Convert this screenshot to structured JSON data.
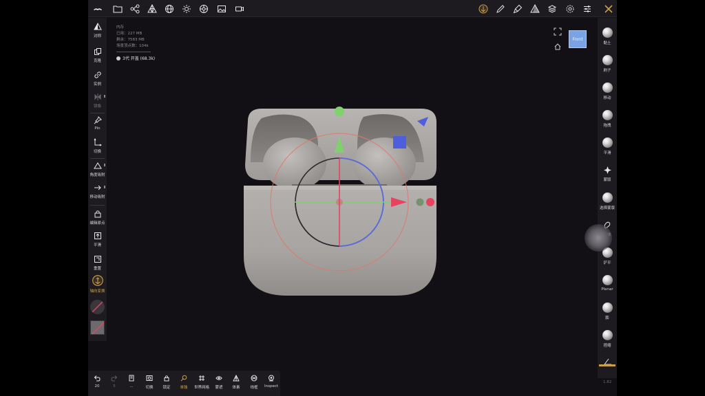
{
  "stats": {
    "memory_label": "内存",
    "used": "已用：227 MB",
    "remaining": "剩余：7583 MB",
    "vertices": "场景顶点数：104k"
  },
  "object": {
    "name": "3代 开盖 (68.3k)"
  },
  "view": {
    "cube_label": "Front"
  },
  "left_tools": [
    {
      "label": "对称"
    },
    {
      "label": "克隆"
    },
    {
      "label": "实例"
    },
    {
      "label": "镜像"
    },
    {
      "label": "Pin"
    },
    {
      "label": "切换"
    },
    {
      "label": "角度吸附"
    },
    {
      "label": "移动吸附"
    },
    {
      "label": "编辑原点"
    },
    {
      "label": "平滑"
    },
    {
      "label": "重置"
    },
    {
      "label": "轴向变换"
    }
  ],
  "right_tools": [
    {
      "label": "黏土"
    },
    {
      "label": "刷子"
    },
    {
      "label": "移动"
    },
    {
      "label": "拖拽"
    },
    {
      "label": "平滑"
    },
    {
      "label": "蒙版"
    },
    {
      "label": "选择蒙版"
    },
    {
      "label": "涂抹"
    },
    {
      "label": "铲平"
    },
    {
      "label": "Planar"
    },
    {
      "label": "膨"
    },
    {
      "label": "捏缩"
    }
  ],
  "bottom_tools": [
    {
      "label": "20"
    },
    {
      "label": "5"
    },
    {
      "label": "..."
    },
    {
      "label": "切换"
    },
    {
      "label": "锁定"
    },
    {
      "label": "单独"
    },
    {
      "label": "世界网格"
    },
    {
      "label": "雾遮"
    },
    {
      "label": "体素"
    },
    {
      "label": "线框"
    },
    {
      "label": "Inspect"
    }
  ],
  "version": "1.82",
  "colors": {
    "accent": "#c9a14a",
    "axis_x": "#e5435e",
    "axis_y": "#7fd26b",
    "axis_z": "#5a6de0",
    "ring_camera": "#e0786a",
    "viewcube": "#7aa3e6",
    "model": "#a8a5a2"
  }
}
